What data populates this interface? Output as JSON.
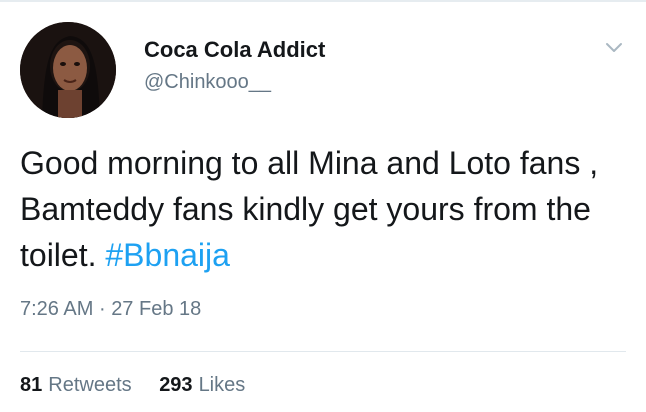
{
  "user": {
    "display_name": "Coca Cola Addict",
    "handle": "@Chinkooo__",
    "avatar_icon": "profile-photo"
  },
  "tweet": {
    "text_main": "Good morning to all Mina and Loto fans , Bamteddy fans kindly get yours from the toilet.",
    "hashtag": "#Bbnaija",
    "time": "7:26 AM",
    "separator": "·",
    "date": "27 Feb 18"
  },
  "stats": {
    "retweets_count": "81",
    "retweets_label": "Retweets",
    "likes_count": "293",
    "likes_label": "Likes"
  },
  "colors": {
    "link": "#1da1f2",
    "muted": "#657786",
    "text": "#14171a"
  }
}
